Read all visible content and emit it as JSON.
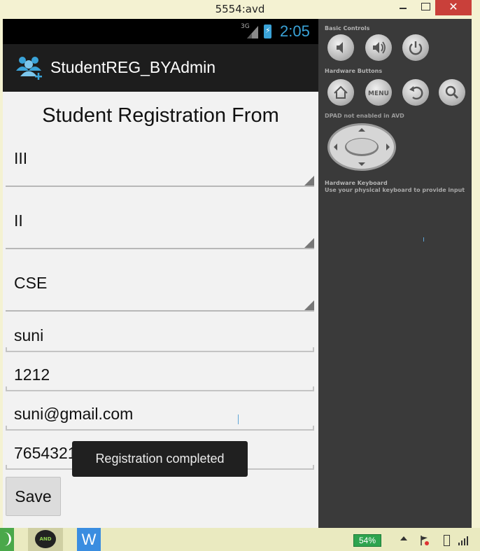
{
  "window": {
    "title": "5554:avd",
    "close_glyph": "✕"
  },
  "status_bar": {
    "network": "3G",
    "time": "2:05"
  },
  "action_bar": {
    "app_icon": "users-add-icon",
    "app_title": "StudentREG_BYAdmin"
  },
  "form": {
    "title": "Student Registration From",
    "year_spinner": "III",
    "semester_spinner": "II",
    "branch_spinner": "CSE",
    "name_field": "suni",
    "rollno_field": "1212",
    "email_field": "suni@gmail.com",
    "phone_field": "7654321789",
    "save_label": "Save"
  },
  "toast": {
    "message": "Registration completed"
  },
  "emulator_panel": {
    "basic_controls_label": "Basic Controls",
    "hardware_buttons_label": "Hardware Buttons",
    "dpad_label": "DPAD not enabled in AVD",
    "keyboard_label": "Hardware Keyboard",
    "keyboard_hint": "Use your physical keyboard to provide input",
    "menu_label": "MENU"
  },
  "taskbar": {
    "android_label": "AND",
    "app_w_label": "W",
    "battery_percent": "54%"
  },
  "colors": {
    "accent": "#3aa3d8",
    "action_bar": "#1d1d1d",
    "panel": "#3a3a3a",
    "toast": "#202020",
    "close_button": "#c9403a"
  }
}
